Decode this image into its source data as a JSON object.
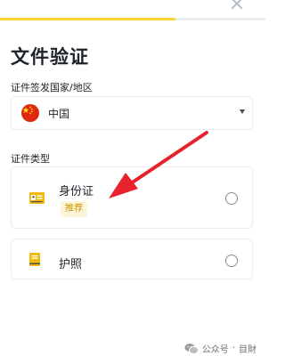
{
  "progress": {
    "fraction": 0.66,
    "fill_color": "#fcd535"
  },
  "header": {
    "close_icon": "close-icon",
    "title": "文件验证"
  },
  "country": {
    "label": "证件签发国家/地区",
    "selected": "中国",
    "flag_icon": "china-flag-icon"
  },
  "document_type": {
    "label": "证件类型",
    "options": [
      {
        "name": "身份证",
        "badge": "推荐",
        "icon": "id-card-icon",
        "selected": false
      },
      {
        "name": "护照",
        "icon": "passport-icon",
        "selected": false
      }
    ]
  },
  "annotation": {
    "arrow_color": "#e8222d"
  },
  "watermark": {
    "channel": "公众号",
    "separator": "·",
    "name": "目財",
    "icon": "wechat-icon"
  }
}
